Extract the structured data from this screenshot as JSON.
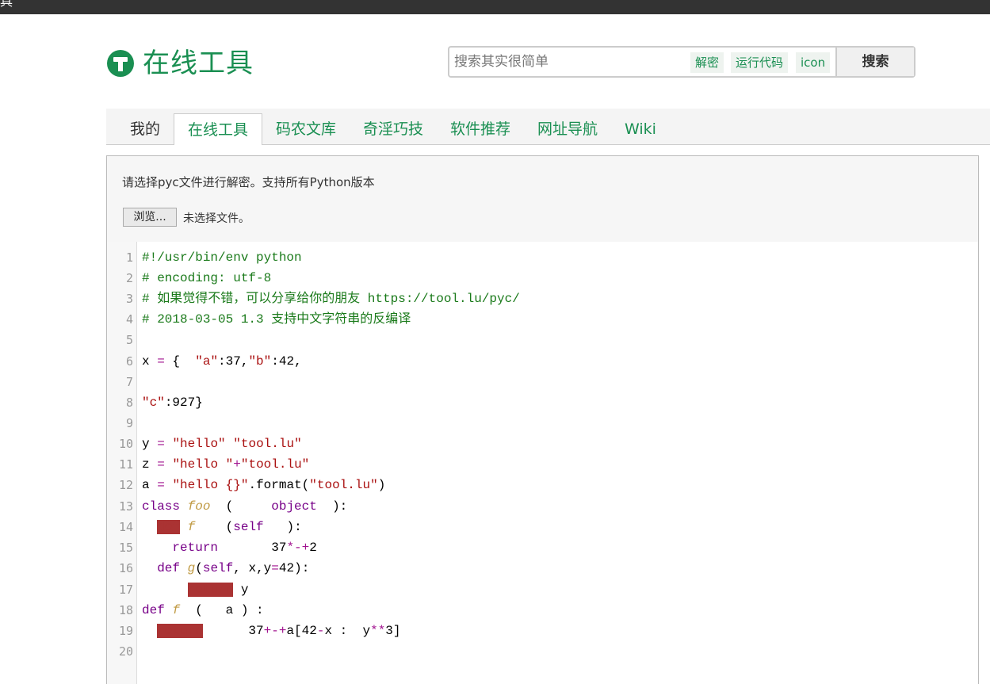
{
  "topbar": {
    "fragment": "具"
  },
  "logo": {
    "text": "在线工具"
  },
  "search": {
    "placeholder": "搜索其实很简单",
    "quick_links": [
      "解密",
      "运行代码",
      "icon"
    ],
    "button": "搜索"
  },
  "nav": {
    "tabs": [
      {
        "label": "我的"
      },
      {
        "label": "在线工具"
      },
      {
        "label": "码农文库"
      },
      {
        "label": "奇淫巧技"
      },
      {
        "label": "软件推荐"
      },
      {
        "label": "网址导航"
      },
      {
        "label": "Wiki"
      }
    ]
  },
  "panel": {
    "description": "请选择pyc文件进行解密。支持所有Python版本",
    "browse_button": "浏览...",
    "file_status": "未选择文件。"
  },
  "editor": {
    "line_numbers": [
      "1",
      "2",
      "3",
      "4",
      "5",
      "6",
      "7",
      "8",
      "9",
      "10",
      "11",
      "12",
      "13",
      "14",
      "15",
      "16",
      "17",
      "18",
      "19",
      "20"
    ],
    "lines": [
      "#!/usr/bin/env python",
      "# encoding: utf-8",
      "# 如果觉得不错，可以分享给你的朋友 https://tool.lu/pyc/",
      "# 2018-03-05 1.3 支持中文字符串的反编译",
      "",
      "x = {  \"a\":37,\"b\":42,",
      "",
      "\"c\":927}",
      "",
      "y = \"hello\" \"tool.lu\"",
      "z = \"hello \"+\"tool.lu\"",
      "a = \"hello {}\".format(\"tool.lu\")",
      "class foo  (     object  ):",
      "  def f    (self   ):",
      "    return       37*-+2",
      "  def g(self, x,y=42):",
      "      return y",
      "def f  (   a ) :",
      "  return      37+-+a[42-x :  y**3]",
      ""
    ]
  },
  "colors": {
    "brand": "#1a8f52",
    "comment": "#1a7a1a",
    "string": "#aa1111",
    "keyword": "#770088",
    "error": "#aa3333"
  }
}
